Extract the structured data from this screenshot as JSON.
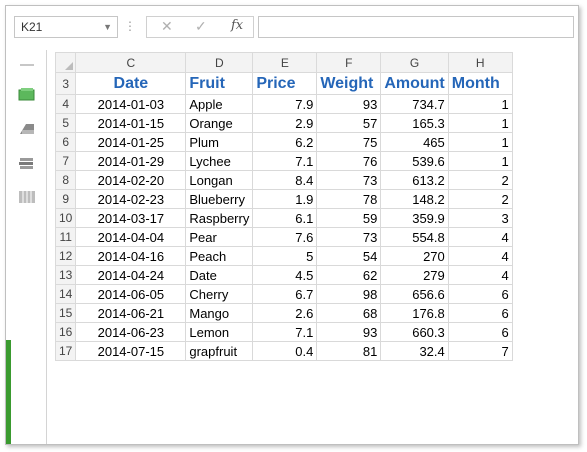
{
  "formula_bar": {
    "name_box": "K21",
    "cancel_symbol": "✕",
    "enter_symbol": "✓",
    "fx_label": "fx",
    "formula_value": ""
  },
  "columns": [
    "C",
    "D",
    "E",
    "F",
    "G",
    "H"
  ],
  "header_row": {
    "row_number": "3",
    "labels": [
      "Date",
      "Fruit",
      "Price",
      "Weight",
      "Amount",
      "Month"
    ]
  },
  "rows": [
    {
      "row_number": "4",
      "date": "2014-01-03",
      "fruit": "Apple",
      "price": "7.9",
      "weight": "93",
      "amount": "734.7",
      "month": "1"
    },
    {
      "row_number": "5",
      "date": "2014-01-15",
      "fruit": "Orange",
      "price": "2.9",
      "weight": "57",
      "amount": "165.3",
      "month": "1"
    },
    {
      "row_number": "6",
      "date": "2014-01-25",
      "fruit": "Plum",
      "price": "6.2",
      "weight": "75",
      "amount": "465",
      "month": "1"
    },
    {
      "row_number": "7",
      "date": "2014-01-29",
      "fruit": "Lychee",
      "price": "7.1",
      "weight": "76",
      "amount": "539.6",
      "month": "1"
    },
    {
      "row_number": "8",
      "date": "2014-02-20",
      "fruit": "Longan",
      "price": "8.4",
      "weight": "73",
      "amount": "613.2",
      "month": "2"
    },
    {
      "row_number": "9",
      "date": "2014-02-23",
      "fruit": "Blueberry",
      "price": "1.9",
      "weight": "78",
      "amount": "148.2",
      "month": "2"
    },
    {
      "row_number": "10",
      "date": "2014-03-17",
      "fruit": "Raspberry",
      "price": "6.1",
      "weight": "59",
      "amount": "359.9",
      "month": "3"
    },
    {
      "row_number": "11",
      "date": "2014-04-04",
      "fruit": "Pear",
      "price": "7.6",
      "weight": "73",
      "amount": "554.8",
      "month": "4"
    },
    {
      "row_number": "12",
      "date": "2014-04-16",
      "fruit": "Peach",
      "price": "5",
      "weight": "54",
      "amount": "270",
      "month": "4"
    },
    {
      "row_number": "13",
      "date": "2014-04-24",
      "fruit": "Date",
      "price": "4.5",
      "weight": "62",
      "amount": "279",
      "month": "4"
    },
    {
      "row_number": "14",
      "date": "2014-06-05",
      "fruit": "Cherry",
      "price": "6.7",
      "weight": "98",
      "amount": "656.6",
      "month": "6"
    },
    {
      "row_number": "15",
      "date": "2014-06-21",
      "fruit": "Mango",
      "price": "2.6",
      "weight": "68",
      "amount": "176.8",
      "month": "6"
    },
    {
      "row_number": "16",
      "date": "2014-06-23",
      "fruit": "Lemon",
      "price": "7.1",
      "weight": "93",
      "amount": "660.3",
      "month": "6"
    },
    {
      "row_number": "17",
      "date": "2014-07-15",
      "fruit": "grapfruit",
      "price": "0.4",
      "weight": "81",
      "amount": "32.4",
      "month": "7"
    }
  ],
  "tools": [
    "green-sheet-icon",
    "eraser-icon",
    "stack-icon",
    "columns-icon"
  ],
  "colors": {
    "header_text": "#2566b8",
    "accent_green": "#3a9a2f"
  }
}
